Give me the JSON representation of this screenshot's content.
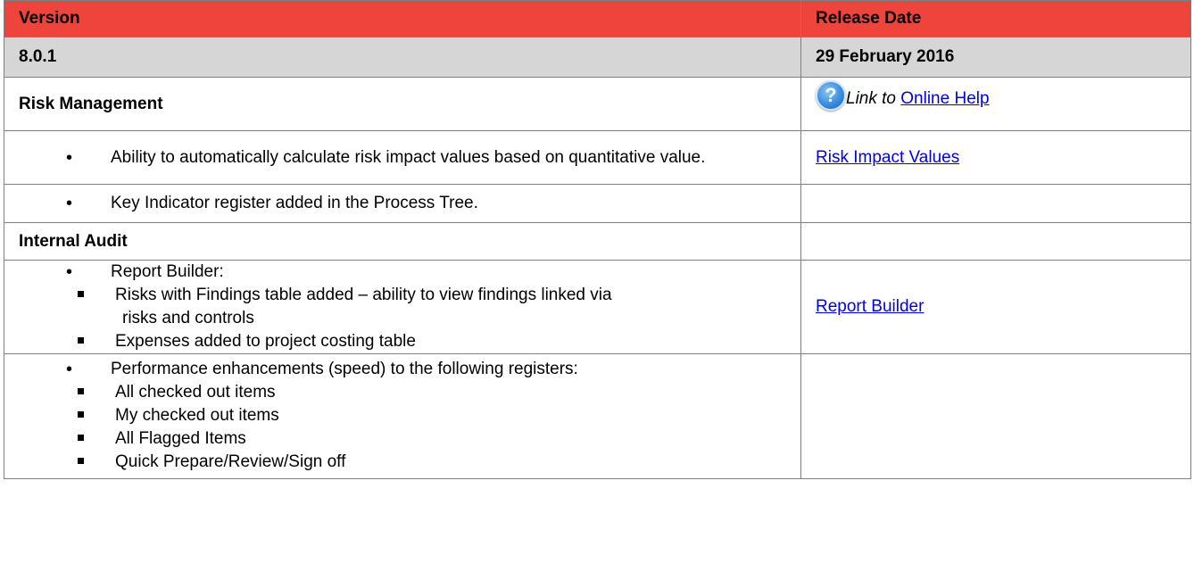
{
  "header": {
    "version_label": "Version",
    "release_date_label": "Release Date"
  },
  "release": {
    "version": "8.0.1",
    "date": "29 February 2016"
  },
  "risk_section": {
    "title": "Risk Management",
    "help_icon": "question-mark-icon",
    "link_to_prefix": "Link to",
    "online_help_link": "Online Help"
  },
  "risk_items": [
    {
      "text": "Ability to automatically calculate risk impact values based on quantitative value.",
      "link": "Risk Impact Values"
    },
    {
      "text": "Key Indicator register added in the Process Tree.",
      "link": ""
    }
  ],
  "audit_section": {
    "title": "Internal Audit"
  },
  "report_builder": {
    "text": "Report Builder:",
    "sub_items": [
      {
        "line1": "Risks with Findings table added – ability to view findings linked via",
        "line2": "risks and controls"
      },
      {
        "line1": "Expenses added to project costing table",
        "line2": ""
      }
    ],
    "link": "Report Builder"
  },
  "performance": {
    "text": "Performance enhancements (speed) to the following registers:",
    "sub_items": [
      "All checked out items",
      "My checked out items",
      "All Flagged Items",
      "Quick Prepare/Review/Sign off"
    ]
  },
  "colors": {
    "header_bg": "#ef443b",
    "version_bg": "#d6d6d6",
    "link": "#0000ee"
  }
}
